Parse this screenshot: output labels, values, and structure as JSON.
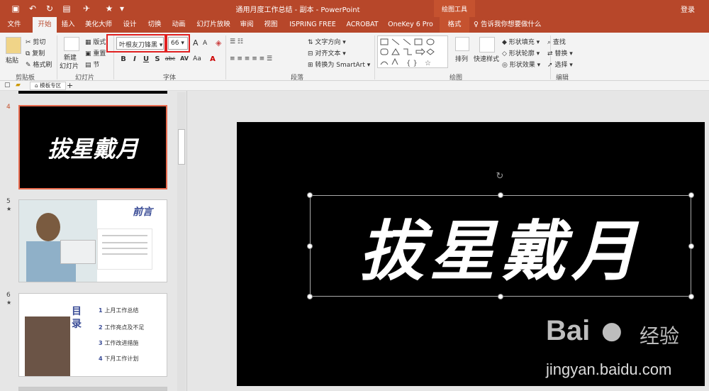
{
  "titlebar": {
    "doc_title": "通用月度工作总结 - 副本 - PowerPoint",
    "tools_label": "绘图工具",
    "login": "登录"
  },
  "tabs": [
    "文件",
    "开始",
    "插入",
    "美化大师",
    "设计",
    "切换",
    "动画",
    "幻灯片放映",
    "审阅",
    "视图",
    "ISPRING FREE 7",
    "ACROBAT",
    "OneKey 6 Pro",
    "格式"
  ],
  "active_tab": "开始",
  "tell_me": "告诉我你想要做什么",
  "ribbon": {
    "clipboard": {
      "paste": "粘贴",
      "cut": "剪切",
      "copy": "复制",
      "painter": "格式刷",
      "label": "剪贴板"
    },
    "slides": {
      "new": "新建",
      "new2": "幻灯片",
      "layout": "版式",
      "reset": "重置",
      "section": "节",
      "label": "幻灯片"
    },
    "font": {
      "name": "叶根友刀锋黑",
      "size": "66",
      "label": "字体",
      "bold": "B",
      "italic": "I",
      "underline": "U",
      "shadow": "S",
      "strike": "abc",
      "spacing": "AV",
      "case": "Aa",
      "grow": "A",
      "shrink": "A"
    },
    "paragraph": {
      "direction": "文字方向",
      "align": "对齐文本",
      "smartart": "转换为 SmartArt",
      "label": "段落"
    },
    "drawing": {
      "arrange": "排列",
      "quick_styles": "快速样式",
      "fill": "形状填充",
      "outline": "形状轮廓",
      "effects": "形状效果",
      "label": "绘图"
    },
    "editing": {
      "find": "查找",
      "replace": "替换",
      "select": "选择",
      "label": "编辑"
    }
  },
  "doc_tab": "模板专区",
  "thumbnails": [
    {
      "num": "4",
      "title": "拔星戴月"
    },
    {
      "num": "5",
      "star": "★",
      "title": "前言"
    },
    {
      "num": "6",
      "star": "★",
      "title": "目录",
      "items": [
        "上月工作总结",
        "工作亮点及不足",
        "工作改进措施",
        "下月工作计划"
      ]
    }
  ],
  "slide": {
    "text": "拔星戴月"
  },
  "watermark": {
    "brand": "Bai",
    "brand2": "经验",
    "url": "jingyan.baidu.com"
  },
  "colors": {
    "accent": "#b7472a",
    "highlight": "#e02020"
  }
}
